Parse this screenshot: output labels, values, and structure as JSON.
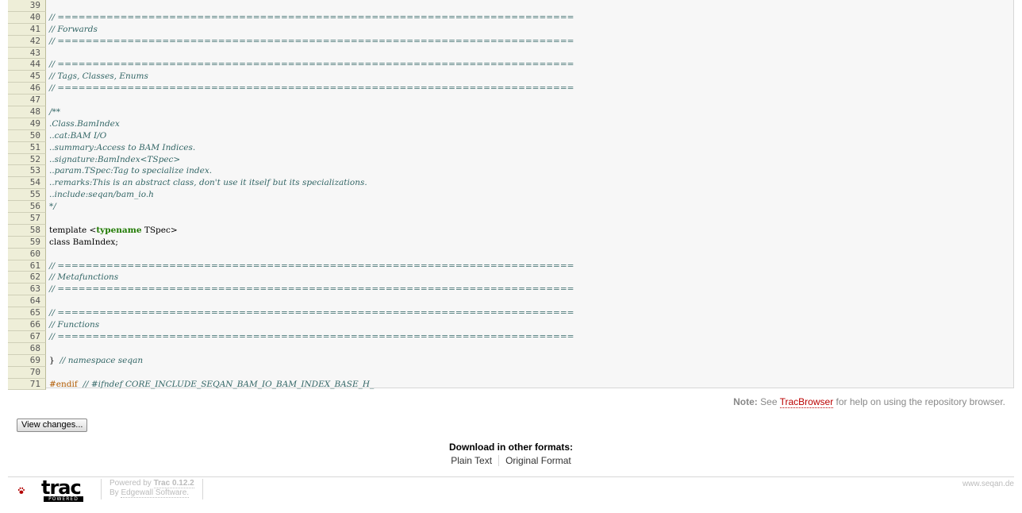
{
  "code": {
    "lines": [
      {
        "n": "39",
        "html": ""
      },
      {
        "n": "40",
        "html": "<span class=\"c\">// ==========================================================================</span>"
      },
      {
        "n": "41",
        "html": "<span class=\"c\">// Forwards</span>"
      },
      {
        "n": "42",
        "html": "<span class=\"c\">// ==========================================================================</span>"
      },
      {
        "n": "43",
        "html": ""
      },
      {
        "n": "44",
        "html": "<span class=\"c\">// ==========================================================================</span>"
      },
      {
        "n": "45",
        "html": "<span class=\"c\">// Tags, Classes, Enums</span>"
      },
      {
        "n": "46",
        "html": "<span class=\"c\">// ==========================================================================</span>"
      },
      {
        "n": "47",
        "html": ""
      },
      {
        "n": "48",
        "html": "<span class=\"c\">/**</span>"
      },
      {
        "n": "49",
        "html": "<span class=\"c\">.Class.BamIndex</span>"
      },
      {
        "n": "50",
        "html": "<span class=\"c\">..cat:BAM I/O</span>"
      },
      {
        "n": "51",
        "html": "<span class=\"c\">..summary:Access to BAM Indices.</span>"
      },
      {
        "n": "52",
        "html": "<span class=\"c\">..signature:BamIndex&lt;TSpec&gt;</span>"
      },
      {
        "n": "53",
        "html": "<span class=\"c\">..param.TSpec:Tag to specialize index.</span>"
      },
      {
        "n": "54",
        "html": "<span class=\"c\">..remarks:This is an abstract class, don't use it itself but its specializations.</span>"
      },
      {
        "n": "55",
        "html": "<span class=\"c\">..include:seqan/bam_io.h</span>"
      },
      {
        "n": "56",
        "html": "<span class=\"c\">*/</span>"
      },
      {
        "n": "57",
        "html": ""
      },
      {
        "n": "58",
        "html": "template &lt;<span class=\"kw\">typename</span> TSpec&gt;"
      },
      {
        "n": "59",
        "html": "class BamIndex;"
      },
      {
        "n": "60",
        "html": ""
      },
      {
        "n": "61",
        "html": "<span class=\"c\">// ==========================================================================</span>"
      },
      {
        "n": "62",
        "html": "<span class=\"c\">// Metafunctions</span>"
      },
      {
        "n": "63",
        "html": "<span class=\"c\">// ==========================================================================</span>"
      },
      {
        "n": "64",
        "html": ""
      },
      {
        "n": "65",
        "html": "<span class=\"c\">// ==========================================================================</span>"
      },
      {
        "n": "66",
        "html": "<span class=\"c\">// Functions</span>"
      },
      {
        "n": "67",
        "html": "<span class=\"c\">// ==========================================================================</span>"
      },
      {
        "n": "68",
        "html": ""
      },
      {
        "n": "69",
        "html": "}  <span class=\"c\">// namespace seqan</span>"
      },
      {
        "n": "70",
        "html": ""
      },
      {
        "n": "71",
        "html": "<span class=\"pp\">#endif</span>  <span class=\"c\">// #ifndef CORE_INCLUDE_SEQAN_BAM_IO_BAM_INDEX_BASE_H_</span>"
      }
    ]
  },
  "help": {
    "note_label": "Note:",
    "see": "See",
    "link": "TracBrowser",
    "rest": "for help on using the repository browser."
  },
  "view_changes": "View changes...",
  "download": {
    "heading": "Download in other formats:",
    "formats": [
      "Plain Text",
      "Original Format"
    ]
  },
  "footer": {
    "logo_word": "trac",
    "logo_badge": "POWERED",
    "powered_by": "Powered by",
    "trac_version": "Trac 0.12.2",
    "by": "By",
    "company": "Edgewall Software.",
    "site": "www.seqan.de"
  }
}
